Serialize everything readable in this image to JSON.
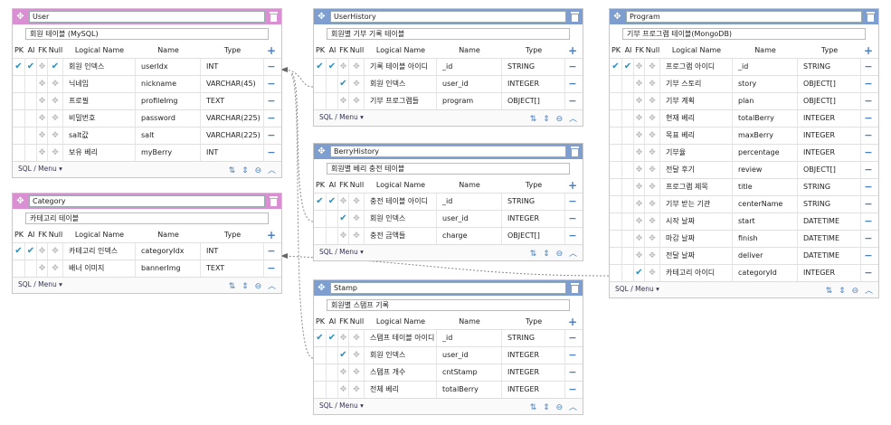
{
  "colors": {
    "pink": "#d98fd2",
    "blue": "#7e9ecf",
    "check": "#2a8fbd",
    "icon": "#4a7fc0"
  },
  "headers": {
    "pk": "PK",
    "ai": "AI",
    "fk": "FK",
    "null": "Null",
    "logical": "Logical Name",
    "name": "Name",
    "type": "Type"
  },
  "footer_menu": "SQL / Menu",
  "tables": {
    "user": {
      "title": "User",
      "comment": "회원 테이블 (MySQL)",
      "rows": [
        {
          "pk": true,
          "ai": true,
          "fk": false,
          "null": true,
          "logical": "회원 인덱스",
          "name": "userIdx",
          "type": "INT"
        },
        {
          "pk": false,
          "ai": false,
          "fk": false,
          "null": false,
          "logical": "닉네임",
          "name": "nickname",
          "type": "VARCHAR(45)"
        },
        {
          "pk": false,
          "ai": false,
          "fk": false,
          "null": false,
          "logical": "프로필",
          "name": "profileImg",
          "type": "TEXT"
        },
        {
          "pk": false,
          "ai": false,
          "fk": false,
          "null": false,
          "logical": "비밀번호",
          "name": "password",
          "type": "VARCHAR(225)"
        },
        {
          "pk": false,
          "ai": false,
          "fk": false,
          "null": false,
          "logical": "salt값",
          "name": "salt",
          "type": "VARCHAR(225)"
        },
        {
          "pk": false,
          "ai": false,
          "fk": false,
          "null": false,
          "logical": "보유 베리",
          "name": "myBerry",
          "type": "INT"
        }
      ]
    },
    "category": {
      "title": "Category",
      "comment": "카테고리 테이블",
      "rows": [
        {
          "pk": true,
          "ai": true,
          "fk": false,
          "null": false,
          "logical": "카테고리 인덱스",
          "name": "categoryIdx",
          "type": "INT"
        },
        {
          "pk": false,
          "ai": false,
          "fk": false,
          "null": false,
          "logical": "배너 이미지",
          "name": "bannerImg",
          "type": "TEXT"
        }
      ]
    },
    "userhistory": {
      "title": "UserHistory",
      "comment": "회원별 기부 기록 테이블",
      "rows": [
        {
          "pk": true,
          "ai": true,
          "fk": false,
          "null": false,
          "logical": "기록 테이블 아이디",
          "name": "_id",
          "type": "STRING"
        },
        {
          "pk": false,
          "ai": false,
          "fk": true,
          "null": false,
          "logical": "회원 인덱스",
          "name": "user_id",
          "type": "INTEGER"
        },
        {
          "pk": false,
          "ai": false,
          "fk": false,
          "null": false,
          "logical": "기부 프로그램들",
          "name": "program",
          "type": "OBJECT[]"
        }
      ]
    },
    "berryhistory": {
      "title": "BerryHistory",
      "comment": "회원별 베리 충전 테이블",
      "rows": [
        {
          "pk": true,
          "ai": true,
          "fk": false,
          "null": false,
          "logical": "충전 테이블 아이디",
          "name": "_id",
          "type": "STRING"
        },
        {
          "pk": false,
          "ai": false,
          "fk": true,
          "null": false,
          "logical": "회원 인덱스",
          "name": "user_id",
          "type": "INTEGER"
        },
        {
          "pk": false,
          "ai": false,
          "fk": false,
          "null": false,
          "logical": "충전 금액들",
          "name": "charge",
          "type": "OBJECT[]"
        }
      ]
    },
    "stamp": {
      "title": "Stamp",
      "comment": "회원별 스탬프 기록",
      "rows": [
        {
          "pk": true,
          "ai": true,
          "fk": false,
          "null": false,
          "logical": "스탬프 테이블 아이디",
          "name": "_id",
          "type": "STRING"
        },
        {
          "pk": false,
          "ai": false,
          "fk": true,
          "null": false,
          "logical": "회원 인덱스",
          "name": "user_id",
          "type": "INTEGER"
        },
        {
          "pk": false,
          "ai": false,
          "fk": false,
          "null": false,
          "logical": "스탬프 개수",
          "name": "cntStamp",
          "type": "INTEGER"
        },
        {
          "pk": false,
          "ai": false,
          "fk": false,
          "null": false,
          "logical": "전체 베리",
          "name": "totalBerry",
          "type": "INTEGER"
        }
      ]
    },
    "program": {
      "title": "Program",
      "comment": "기부 프로그램 테이블(MongoDB)",
      "rows": [
        {
          "pk": true,
          "ai": true,
          "fk": false,
          "null": false,
          "logical": "프로그램 아이디",
          "name": "_id",
          "type": "STRING"
        },
        {
          "pk": false,
          "ai": false,
          "fk": false,
          "null": false,
          "logical": "기부 스토리",
          "name": "story",
          "type": "OBJECT[]"
        },
        {
          "pk": false,
          "ai": false,
          "fk": false,
          "null": false,
          "logical": "기부 계획",
          "name": "plan",
          "type": "OBJECT[]"
        },
        {
          "pk": false,
          "ai": false,
          "fk": false,
          "null": false,
          "logical": "현재 베리",
          "name": "totalBerry",
          "type": "INTEGER"
        },
        {
          "pk": false,
          "ai": false,
          "fk": false,
          "null": false,
          "logical": "목표 베리",
          "name": "maxBerry",
          "type": "INTEGER"
        },
        {
          "pk": false,
          "ai": false,
          "fk": false,
          "null": false,
          "logical": "기부율",
          "name": "percentage",
          "type": "INTEGER"
        },
        {
          "pk": false,
          "ai": false,
          "fk": false,
          "null": false,
          "logical": "전달 후기",
          "name": "review",
          "type": "OBJECT[]"
        },
        {
          "pk": false,
          "ai": false,
          "fk": false,
          "null": false,
          "logical": "프로그램 제목",
          "name": "title",
          "type": "STRING"
        },
        {
          "pk": false,
          "ai": false,
          "fk": false,
          "null": false,
          "logical": "기부 받는 기관",
          "name": "centerName",
          "type": "STRING"
        },
        {
          "pk": false,
          "ai": false,
          "fk": false,
          "null": false,
          "logical": "시작 날짜",
          "name": "start",
          "type": "DATETIME"
        },
        {
          "pk": false,
          "ai": false,
          "fk": false,
          "null": false,
          "logical": "마감 날짜",
          "name": "finish",
          "type": "DATETIME"
        },
        {
          "pk": false,
          "ai": false,
          "fk": false,
          "null": false,
          "logical": "전달 날짜",
          "name": "deliver",
          "type": "DATETIME"
        },
        {
          "pk": false,
          "ai": false,
          "fk": true,
          "null": false,
          "logical": "카테고리 아이디",
          "name": "categoryId",
          "type": "INTEGER"
        }
      ]
    }
  }
}
